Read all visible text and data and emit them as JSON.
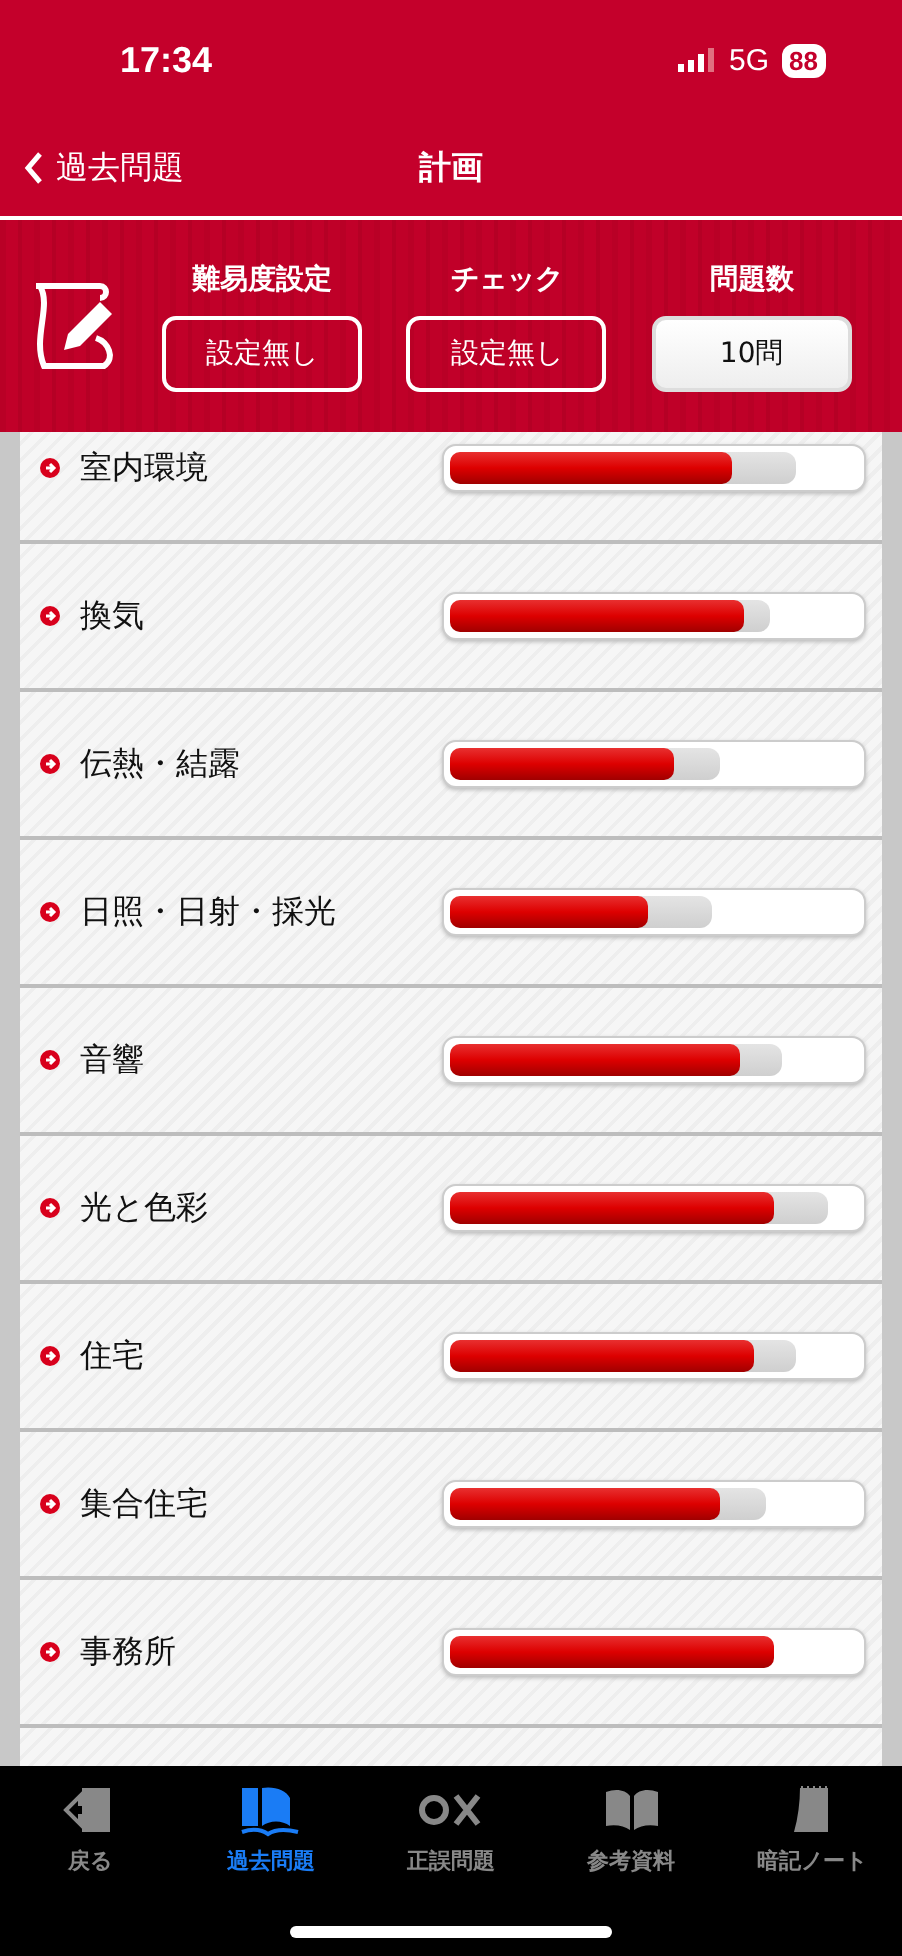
{
  "status_bar": {
    "time": "17:34",
    "network": "5G",
    "battery": "88"
  },
  "nav": {
    "back": "過去問題",
    "title": "計画"
  },
  "settings": [
    {
      "label": "難易度設定",
      "value": "設定無し",
      "kind": "outline"
    },
    {
      "label": "チェック",
      "value": "設定無し",
      "kind": "outline"
    },
    {
      "label": "問題数",
      "value": "10問",
      "kind": "solid"
    }
  ],
  "topics": [
    {
      "name": "室内環境",
      "correct": {
        "level": 0.7
      },
      "attempted": {
        "level": 0.85
      }
    },
    {
      "name": "換気",
      "correct": {
        "level": 0.73
      },
      "attempted": {
        "level": 0.79
      }
    },
    {
      "name": "伝熱・結露",
      "correct": {
        "level": 0.56
      },
      "attempted": {
        "level": 0.67
      }
    },
    {
      "name": "日照・日射・採光",
      "correct": {
        "level": 0.5
      },
      "attempted": {
        "level": 0.65
      }
    },
    {
      "name": "音響",
      "correct": {
        "level": 0.72
      },
      "attempted": {
        "level": 0.82
      }
    },
    {
      "name": "光と色彩",
      "correct": {
        "level": 0.8
      },
      "attempted": {
        "level": 0.93
      }
    },
    {
      "name": "住宅",
      "correct": {
        "level": 0.75
      },
      "attempted": {
        "level": 0.85
      }
    },
    {
      "name": "集合住宅",
      "correct": {
        "level": 0.67
      },
      "attempted": {
        "level": 0.78
      }
    },
    {
      "name": "事務所",
      "correct": {
        "level": 0.8
      },
      "attempted": {
        "level": 0.8
      }
    }
  ],
  "tab_bar": [
    {
      "label": "戻る",
      "kind": "back",
      "selected": false
    },
    {
      "label": "過去問題",
      "kind": "book",
      "selected": true
    },
    {
      "label": "正誤問題",
      "kind": "ox",
      "selected": false
    },
    {
      "label": "参考資料",
      "kind": "open-book",
      "selected": false
    },
    {
      "label": "暗記ノート",
      "kind": "notebook",
      "selected": false
    }
  ]
}
